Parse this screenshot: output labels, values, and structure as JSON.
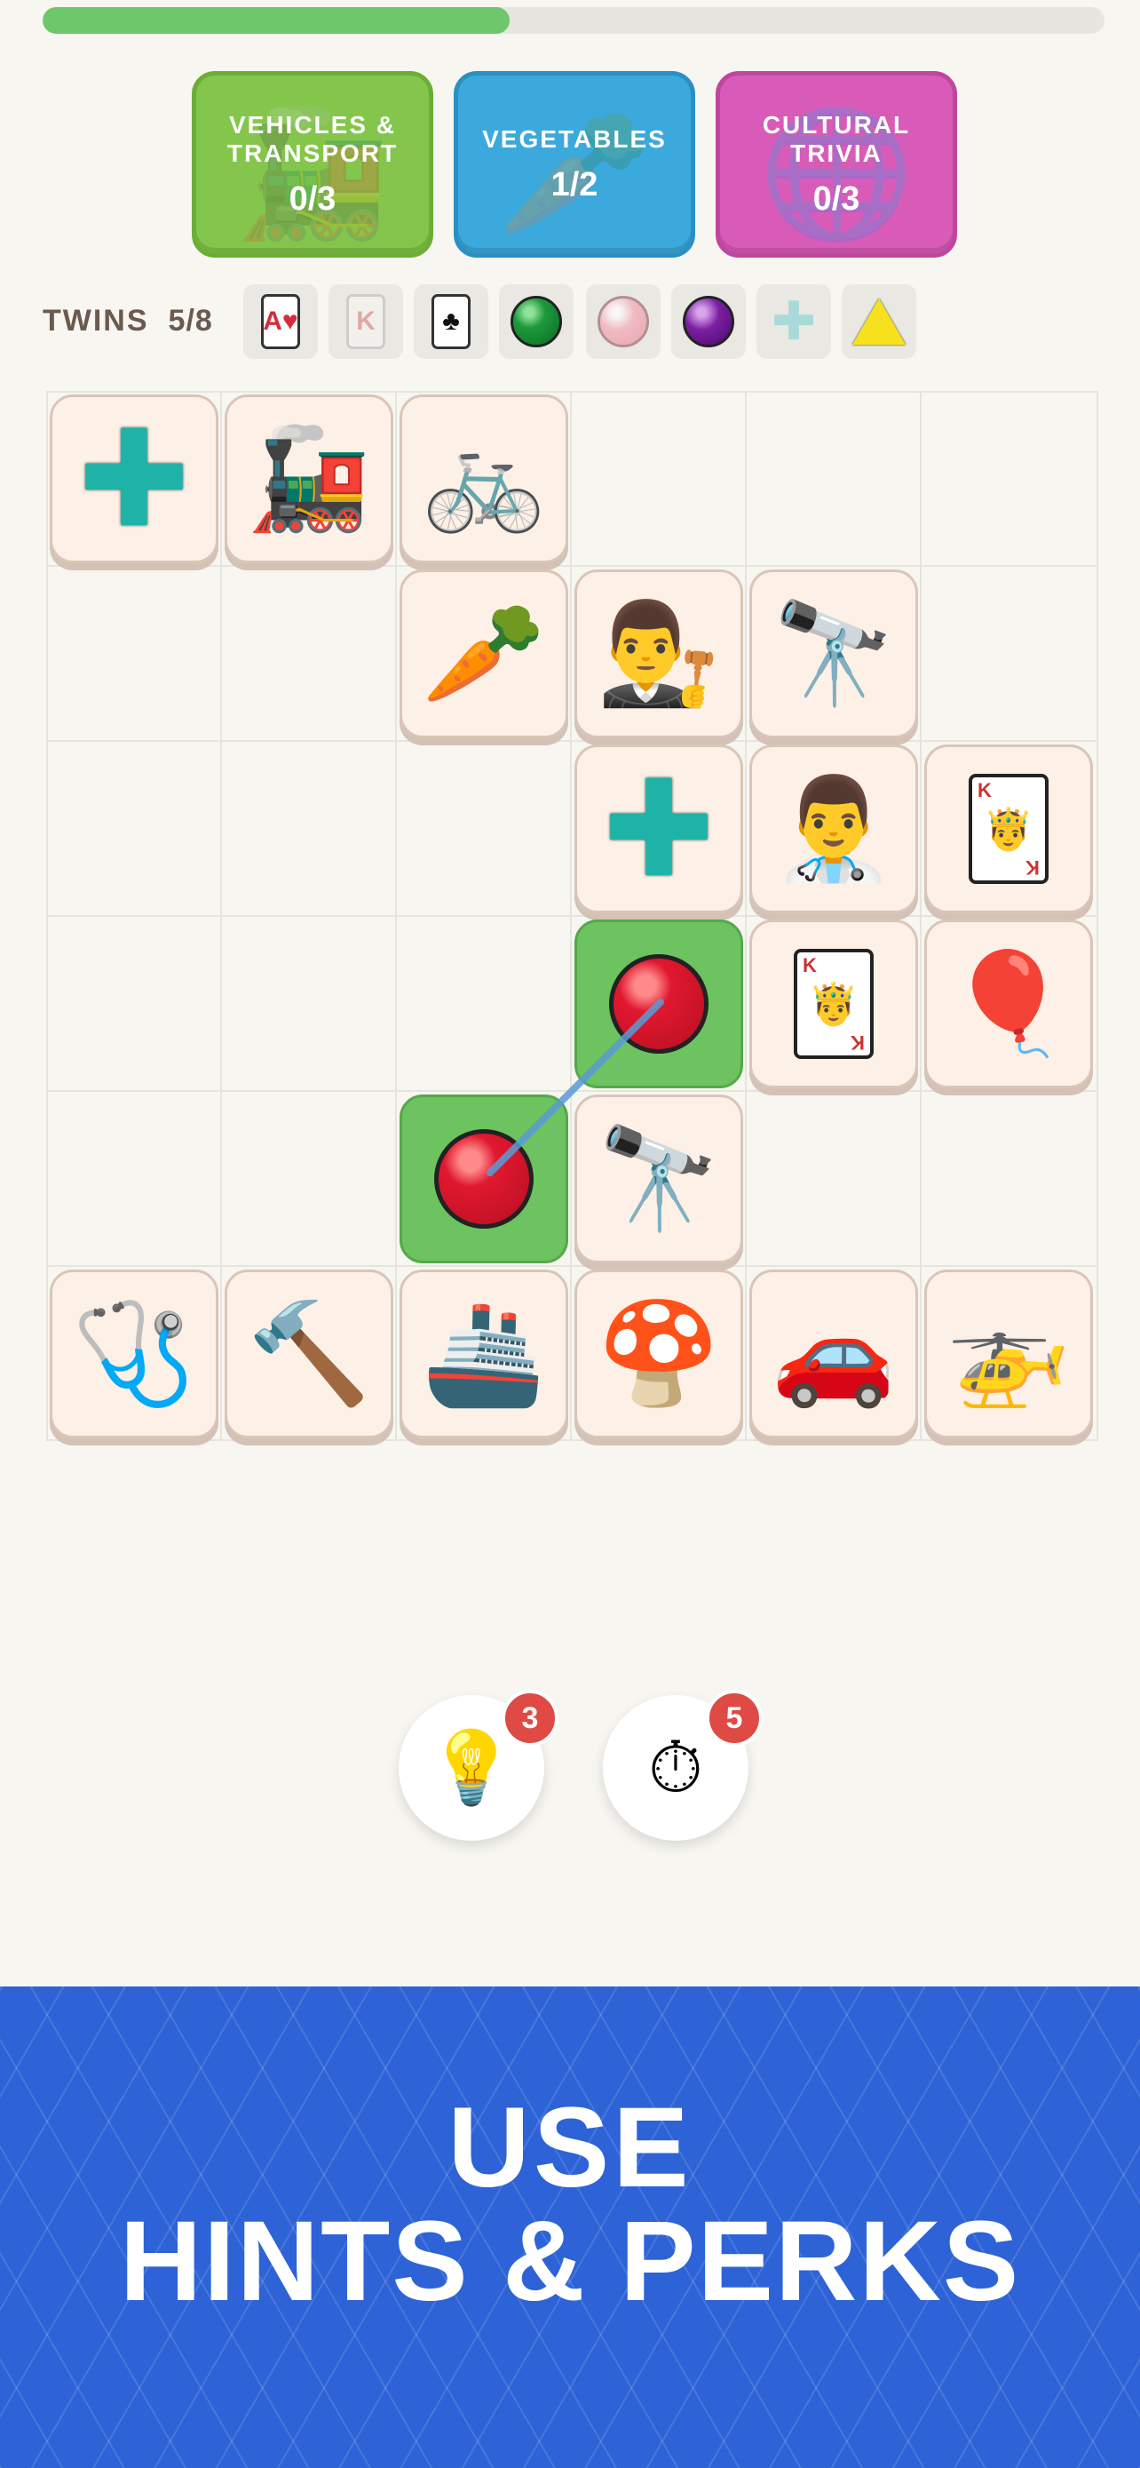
{
  "progress": {
    "value": 0.44
  },
  "categories": [
    {
      "name": "VEHICLES & TRANSPORT",
      "count": "0/3",
      "color": "#83c64b",
      "icon": "locomotive-icon"
    },
    {
      "name": "VEGETABLES",
      "count": "1/2",
      "color": "#3ba9dc",
      "icon": "carrot-icon"
    },
    {
      "name": "CULTURAL TRIVIA",
      "count": "0/3",
      "color": "#d95bb8",
      "icon": "globe-icon"
    }
  ],
  "twins": {
    "label": "TWINS",
    "count": "5/8",
    "items": [
      {
        "icon": "ace-of-hearts-card-icon",
        "text": "A♥"
      },
      {
        "icon": "king-card-faded-icon",
        "text": "K"
      },
      {
        "icon": "club-card-icon",
        "text": "♣"
      },
      {
        "icon": "green-ball-icon",
        "color": "#1e9a3c"
      },
      {
        "icon": "pink-ball-icon",
        "color": "#f4a9b6"
      },
      {
        "icon": "purple-ball-icon",
        "color": "#7b1fa2"
      },
      {
        "icon": "plus-icon"
      },
      {
        "icon": "yellow-triangle-icon",
        "color": "#f7e11d"
      }
    ]
  },
  "board": {
    "tiles": [
      {
        "icon": "green-cross-icon",
        "glyph": "✚"
      },
      {
        "icon": "train-icon",
        "glyph": "🚂"
      },
      {
        "icon": "bicycle-icon",
        "glyph": "🚲"
      },
      {
        "icon": "carrot-icon",
        "glyph": "🥕"
      },
      {
        "icon": "judge-wig-icon",
        "glyph": "👨‍⚖️"
      },
      {
        "icon": "telescope-icon",
        "glyph": "🔭"
      },
      {
        "icon": "green-cross-icon",
        "glyph": "✚"
      },
      {
        "icon": "doctor-icon",
        "glyph": "👨‍⚕️"
      },
      {
        "icon": "king-card-icon",
        "text": "K",
        "glyph": "🤴"
      },
      {
        "icon": "red-ball-icon",
        "selected": true
      },
      {
        "icon": "king-card-icon",
        "text": "K",
        "glyph": "🤴"
      },
      {
        "icon": "hot-air-balloon-icon",
        "glyph": "🎈"
      },
      {
        "icon": "red-ball-icon",
        "selected": true
      },
      {
        "icon": "astronomer-icon",
        "glyph": "🔭"
      },
      {
        "icon": "stethoscope-icon",
        "glyph": "🩺"
      },
      {
        "icon": "gavel-icon",
        "glyph": "🔨"
      },
      {
        "icon": "submarine-icon",
        "glyph": "🚢"
      },
      {
        "icon": "mushroom-icon",
        "glyph": "🍄"
      },
      {
        "icon": "car-icon",
        "glyph": "🚗"
      },
      {
        "icon": "helicopter-icon",
        "glyph": "🚁"
      }
    ]
  },
  "perks": [
    {
      "icon": "lightbulb-icon",
      "glyph": "💡",
      "badge": "3"
    },
    {
      "icon": "stopwatch-icon",
      "glyph": "⏱",
      "badge": "5"
    }
  ],
  "banner": {
    "line1": "USE",
    "line2": "HINTS & PERKS",
    "color": "#2d63d6"
  }
}
